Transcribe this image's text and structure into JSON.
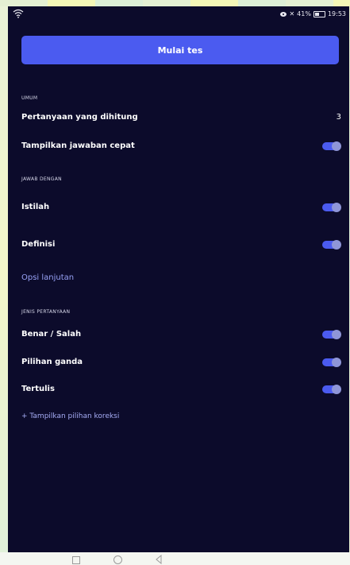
{
  "status_bar": {
    "battery": "41%",
    "time": "19:53"
  },
  "actions": {
    "start_test": "Mulai tes"
  },
  "sections": {
    "general": {
      "heading": "UMUM",
      "count_label": "Pertanyaan yang dihitung",
      "count_value": "3",
      "quick_answers_label": "Tampilkan jawaban cepat",
      "quick_answers_on": true
    },
    "answer_with": {
      "heading": "JAWAB DENGAN",
      "term_label": "Istilah",
      "term_on": true,
      "definition_label": "Definisi",
      "definition_on": true,
      "advanced_options": "Opsi lanjutan"
    },
    "question_types": {
      "heading": "JENIS PERTANYAAN",
      "true_false_label": "Benar / Salah",
      "true_false_on": true,
      "multiple_choice_label": "Pilihan ganda",
      "multiple_choice_on": true,
      "written_label": "Tertulis",
      "written_on": true,
      "show_correction": "+ Tampilkan pilihan koreksi"
    }
  },
  "colors": {
    "background": "#0c0b2b",
    "accent": "#4b5bf0",
    "toggle_knob": "#8f96d8",
    "link": "#98a2f6"
  },
  "icons": {
    "status": [
      "wifi-icon",
      "eye-icon",
      "mute-icon",
      "battery-icon"
    ],
    "nav": [
      "recent-apps-icon",
      "home-icon",
      "back-icon"
    ]
  }
}
